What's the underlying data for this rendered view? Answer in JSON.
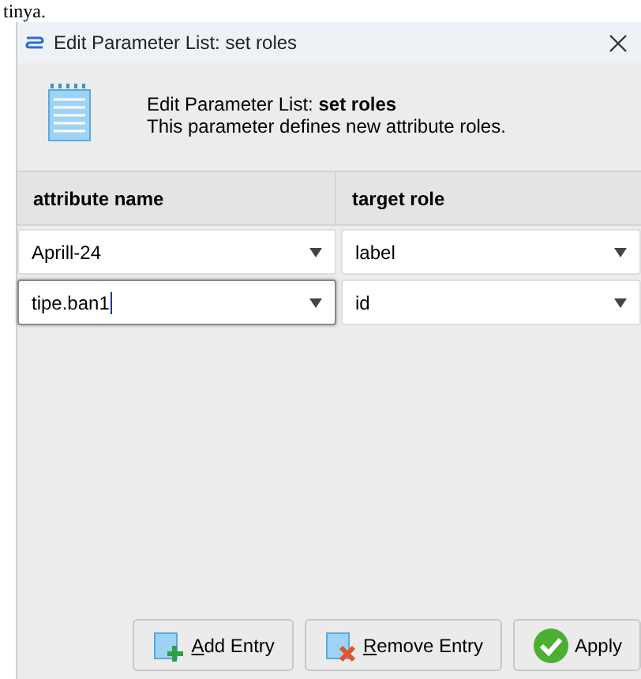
{
  "page_fragment": "tinya.",
  "window": {
    "title": "Edit Parameter List: set roles"
  },
  "header": {
    "title_prefix": "Edit Parameter List: ",
    "title_bold": "set roles",
    "description": "This parameter defines new attribute roles."
  },
  "table": {
    "columns": [
      "attribute name",
      "target role"
    ],
    "rows": [
      {
        "attribute": "Aprill-24",
        "role": "label",
        "focused": false
      },
      {
        "attribute": "tipe.ban1",
        "role": "id",
        "focused": true
      }
    ]
  },
  "buttons": [
    {
      "kind": "add",
      "label": "Add Entry",
      "mnemonic": true
    },
    {
      "kind": "remove",
      "label": "Remove Entry",
      "mnemonic": true
    },
    {
      "kind": "apply",
      "label": "Apply",
      "mnemonic": false
    }
  ]
}
